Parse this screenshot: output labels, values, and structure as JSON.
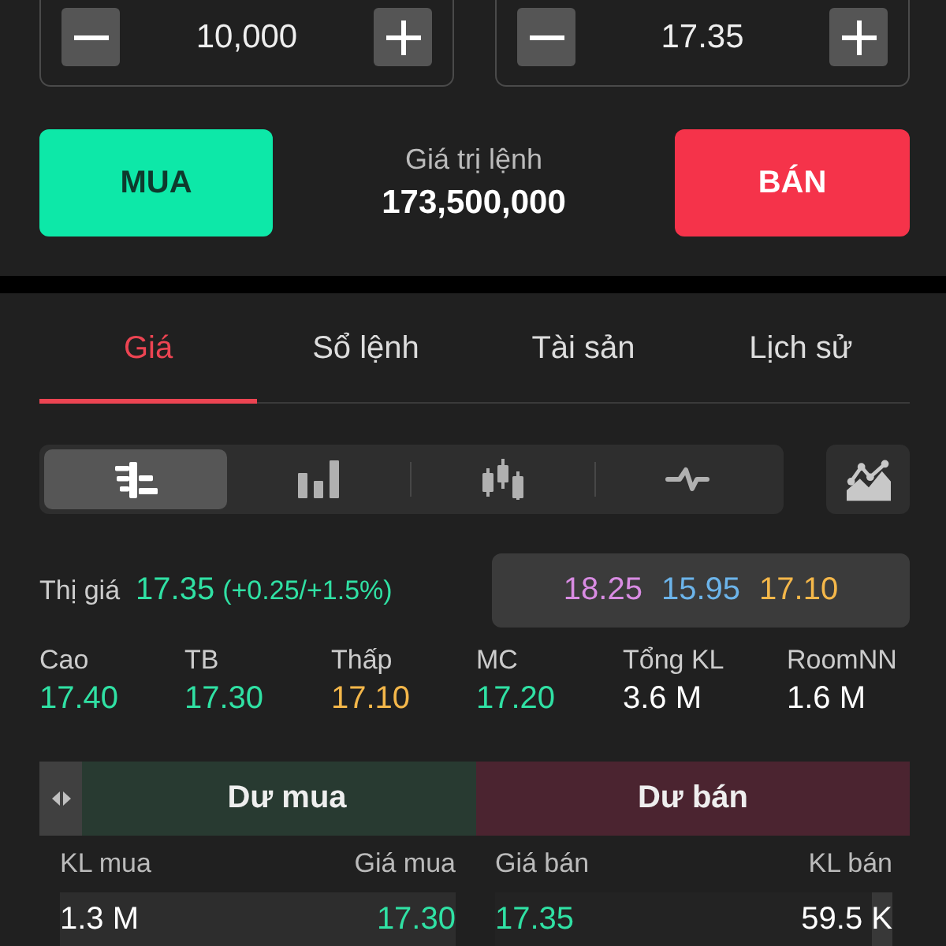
{
  "order_form": {
    "quantity": {
      "value": "10,000"
    },
    "price": {
      "value": "17.35"
    },
    "buy_button": "MUA",
    "order_value": {
      "label": "Giá trị lệnh",
      "value": "173,500,000"
    },
    "sell_button": "BÁN"
  },
  "tabs": [
    {
      "label": "Giá",
      "selected": true
    },
    {
      "label": "Sổ lệnh",
      "selected": false
    },
    {
      "label": "Tài sản",
      "selected": false
    },
    {
      "label": "Lịch sử",
      "selected": false
    }
  ],
  "chart_modes": [
    {
      "kind": "ladder",
      "selected": true
    },
    {
      "kind": "bars",
      "selected": false
    },
    {
      "kind": "candles",
      "selected": false
    },
    {
      "kind": "line",
      "selected": false
    }
  ],
  "quote": {
    "label": "Thị giá",
    "price": "17.35",
    "change": "(+0.25/+1.5%)"
  },
  "reference_prices": [
    {
      "value": "18.25",
      "color": "#d98ce3"
    },
    {
      "value": "15.95",
      "color": "#6cb4ea"
    },
    {
      "value": "17.10",
      "color": "#f4b74a"
    }
  ],
  "stats": [
    {
      "label": "Cao",
      "value": "17.40",
      "color": "#30e1a4"
    },
    {
      "label": "TB",
      "value": "17.30",
      "color": "#30e1a4"
    },
    {
      "label": "Thấp",
      "value": "17.10",
      "color": "#f4b74a"
    },
    {
      "label": "MC",
      "value": "17.20",
      "color": "#30e1a4"
    },
    {
      "label": "Tổng KL",
      "value": "3.6 M",
      "color": "#ffffff"
    },
    {
      "label": "RoomNN",
      "value": "1.6 M",
      "color": "#ffffff"
    }
  ],
  "order_book": {
    "bid_title": "Dư mua",
    "ask_title": "Dư bán",
    "columns": [
      "KL mua",
      "Giá mua",
      "Giá bán",
      "KL bán"
    ],
    "rows": [
      {
        "bid": {
          "volume": "1.3 M",
          "price": "17.30",
          "level": 1
        },
        "ask": {
          "price": "17.35",
          "volume": "59.5 K",
          "level": 0.05
        }
      }
    ]
  }
}
